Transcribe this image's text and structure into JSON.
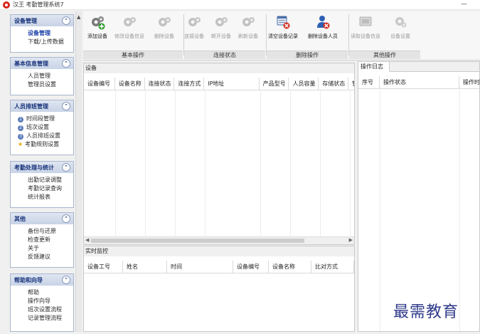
{
  "window": {
    "title": "汉王 考勤管理系统7",
    "min_glyph": "—"
  },
  "sidebar": {
    "groups": [
      {
        "title": "设备管理",
        "items": [
          "设备管理",
          "下载/上传数据"
        ]
      },
      {
        "title": "基本信息管理",
        "items": [
          "人员管理",
          "管理员设置"
        ]
      },
      {
        "title": "人员排班管理",
        "items": [
          "时间段管理",
          "班次设置",
          "人员排班设置",
          "考勤规则设置"
        ]
      },
      {
        "title": "考勤处理与统计",
        "items": [
          "出勤记录调整",
          "考勤记录查询",
          "统计报表"
        ]
      },
      {
        "title": "其他",
        "items": [
          "备份与还原",
          "检查更新",
          "关于",
          "反馈建议"
        ]
      },
      {
        "title": "帮助和向导",
        "items": [
          "帮助",
          "操作向导",
          "班次设置流程",
          "记录管理流程"
        ]
      }
    ],
    "numbers": [
      "1",
      "2",
      "3"
    ],
    "collapse_glyph": "⌃"
  },
  "ribbon": {
    "groups": [
      {
        "label": "基本操作",
        "buttons": [
          "添加设备",
          "修改设备信息",
          "删除设备"
        ]
      },
      {
        "label": "连接状态",
        "buttons": [
          "连接设备",
          "断开设备",
          "刷新设备"
        ]
      },
      {
        "label": "删除操作",
        "buttons": [
          "清空设备记录",
          "删除设备人员"
        ]
      },
      {
        "label": "其他操作",
        "buttons": [
          "读取设备信息",
          "设备设置"
        ]
      }
    ]
  },
  "device_panel": {
    "title": "设备",
    "columns": [
      "设备编号",
      "设备名称",
      "连接状态",
      "连接方式",
      "IP地址",
      "产品型号",
      "人员容量",
      "存储状态",
      "管"
    ]
  },
  "monitor_panel": {
    "title": "实时监控",
    "columns": [
      "设备工号",
      "姓名",
      "时间",
      "设备编号",
      "设备名称",
      "比对方式"
    ]
  },
  "log_panel": {
    "tab": "操作日志",
    "columns": [
      "序号",
      "操作状态",
      "操作时"
    ]
  },
  "watermark": "最需教育",
  "colors": {
    "accent": "#15307a",
    "logo": "#d9261c"
  }
}
